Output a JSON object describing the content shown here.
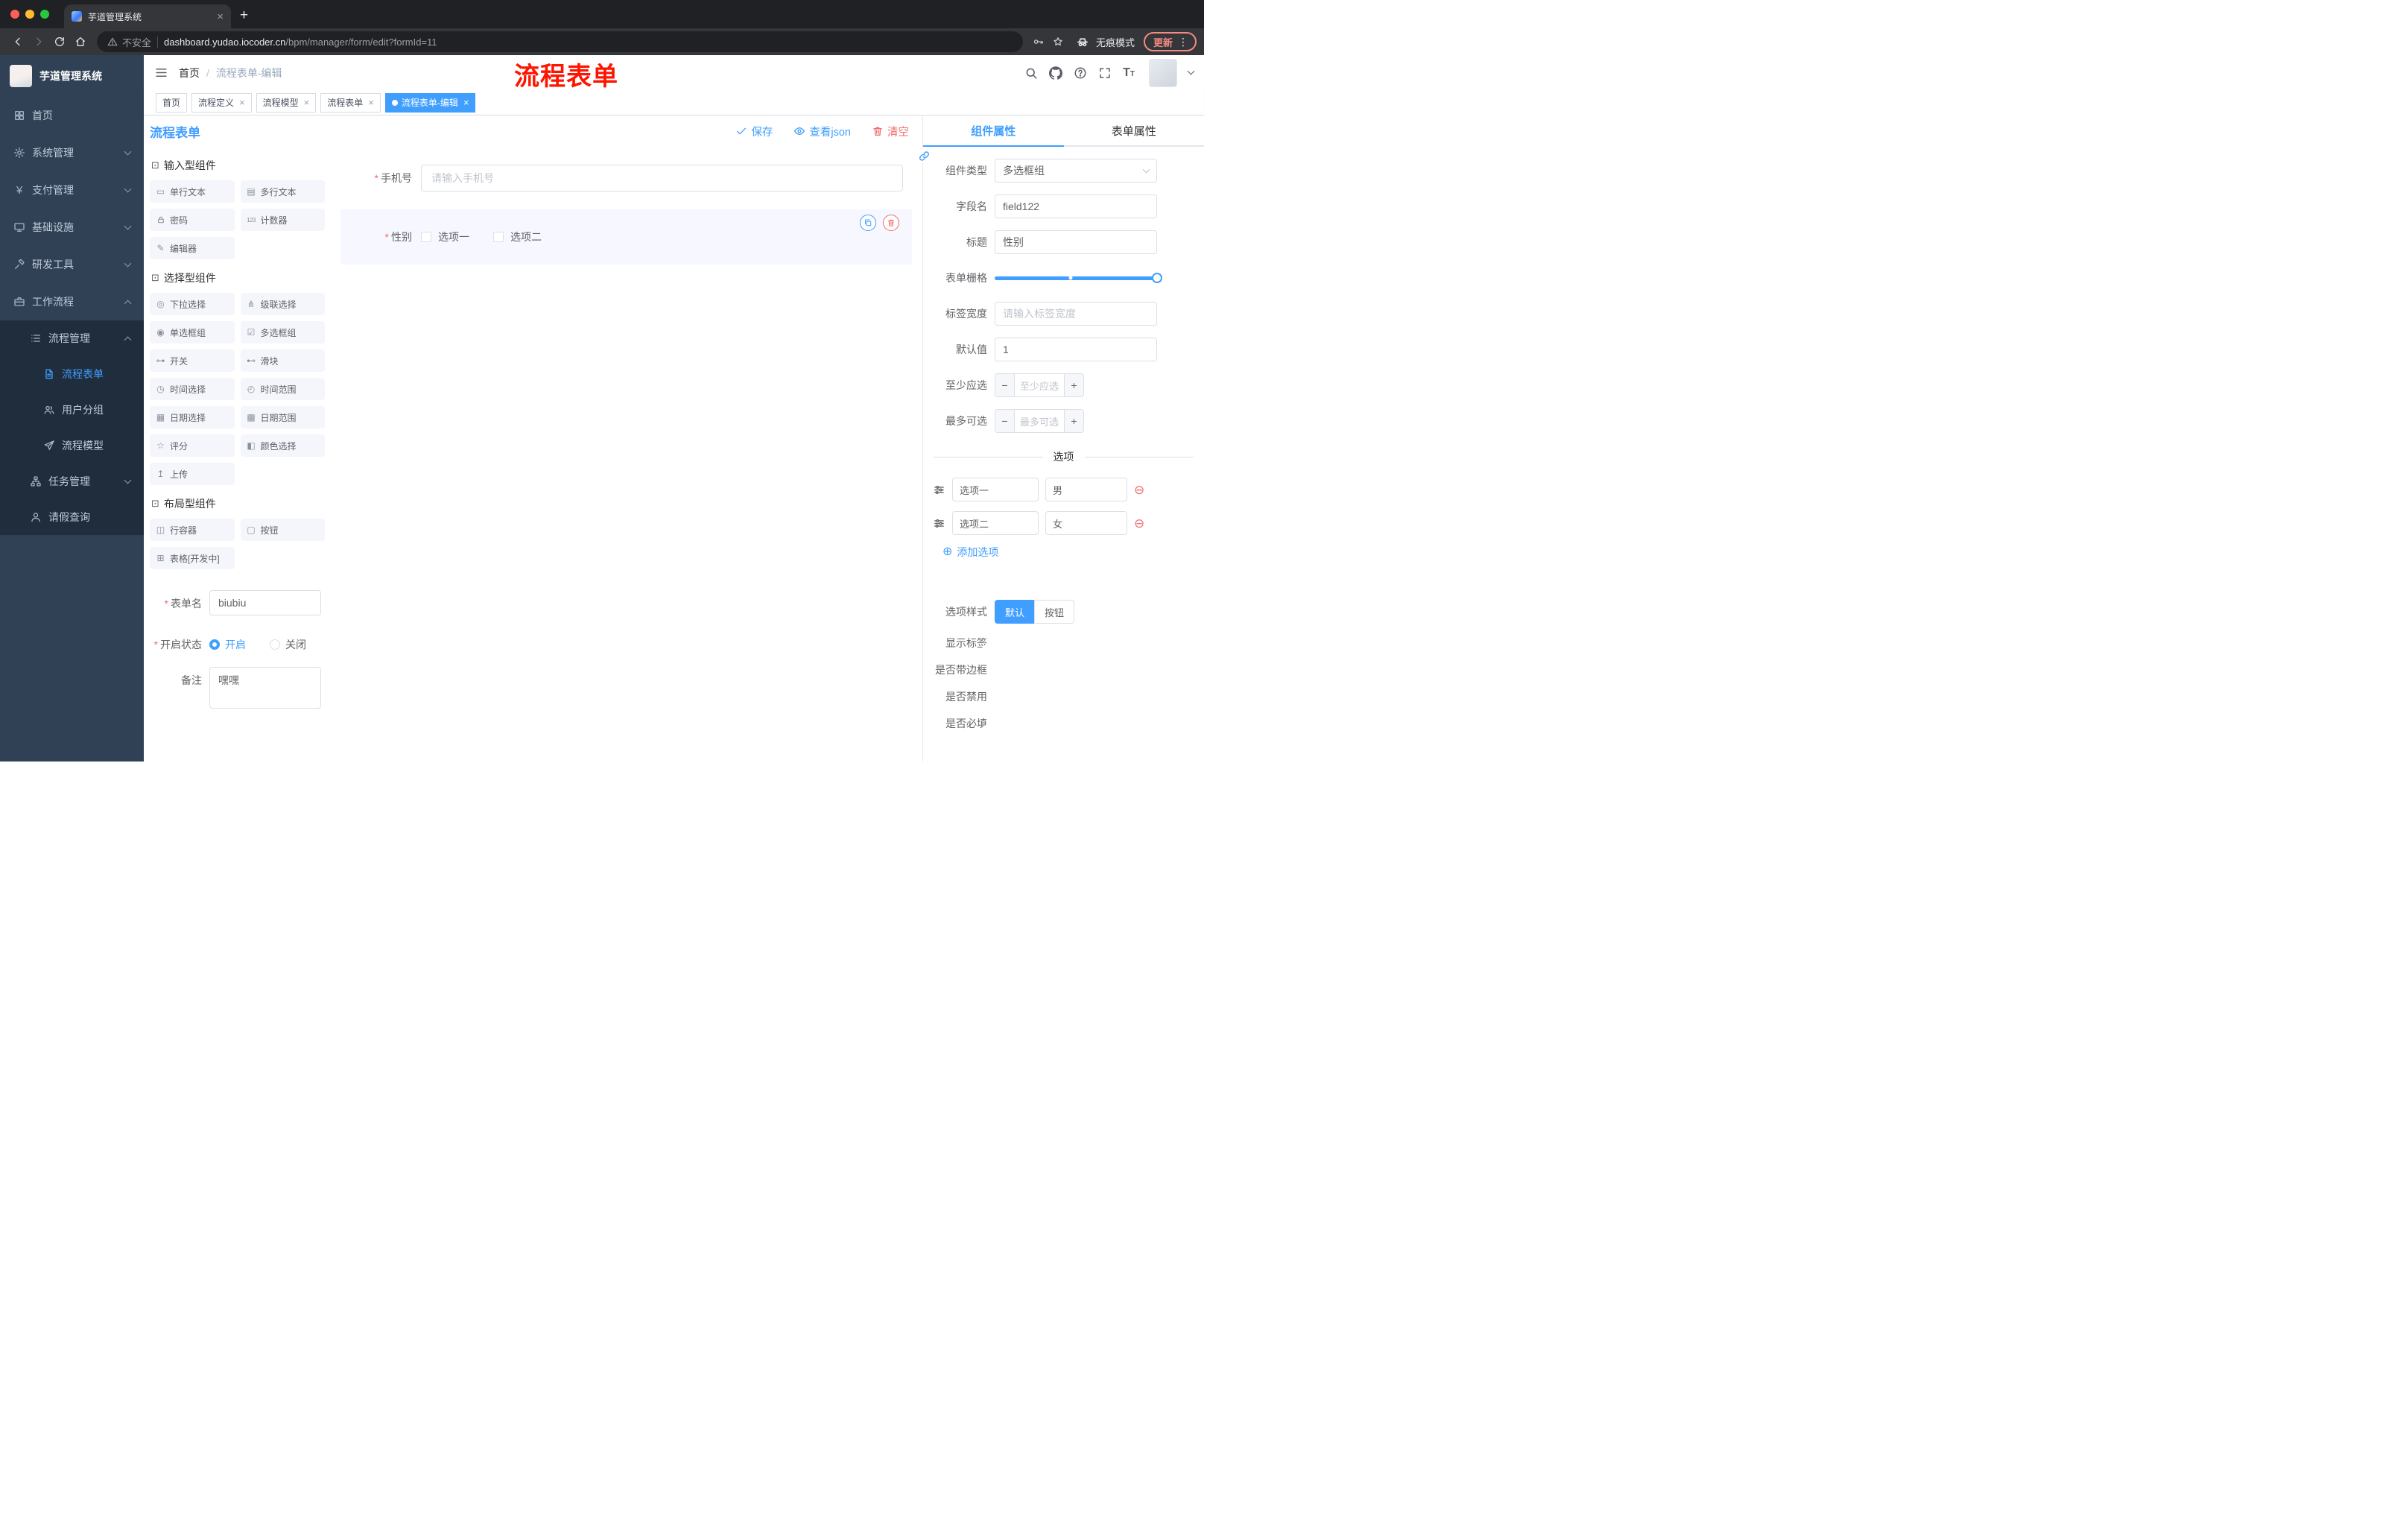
{
  "icons": {
    "yen": "¥",
    "input": "▭",
    "textarea": "▤",
    "counter": "123",
    "editor": "✎",
    "select": "◎",
    "cascader": "⋔",
    "radio": "◉",
    "checkbox_group": "☑",
    "switch": "⊶",
    "slider": "⊷",
    "time": "◷",
    "time_range": "◴",
    "date": "▦",
    "date_range": "▩",
    "rate": "☆",
    "color": "◧",
    "upload": "↥",
    "row": "◫",
    "button": "▢",
    "table": "⊞",
    "group": "⊡",
    "dots": "⋮",
    "minus_circle": "⊖",
    "plus_circle": "⊕",
    "close": "×",
    "plus": "+",
    "minus": "−",
    "slash": "/"
  },
  "browser": {
    "tab": {
      "title": "芋道管理系统"
    },
    "address": {
      "security_label": "不安全",
      "host": "dashboard.yudao.iocoder.cn",
      "path": "/bpm/manager/form/edit?formId=11"
    },
    "incognito_label": "无痕模式",
    "update_label": "更新"
  },
  "sidebar": {
    "logo_title": "芋道管理系统",
    "items": [
      {
        "label": "首页"
      },
      {
        "label": "系统管理"
      },
      {
        "label": "支付管理"
      },
      {
        "label": "基础设施"
      },
      {
        "label": "研发工具"
      },
      {
        "label": "工作流程"
      },
      {
        "label": "流程管理"
      },
      {
        "label": "流程表单"
      },
      {
        "label": "用户分组"
      },
      {
        "label": "流程模型"
      },
      {
        "label": "任务管理"
      },
      {
        "label": "请假查询"
      }
    ]
  },
  "navbar": {
    "breadcrumb": {
      "home": "首页",
      "current": "流程表单-编辑"
    },
    "annotation": "流程表单"
  },
  "tags": [
    {
      "label": "首页"
    },
    {
      "label": "流程定义"
    },
    {
      "label": "流程模型"
    },
    {
      "label": "流程表单"
    },
    {
      "label": "流程表单-编辑"
    }
  ],
  "designer": {
    "title": "流程表单",
    "actions": {
      "save": "保存",
      "view_json": "查看json",
      "clear": "清空"
    },
    "palette": {
      "groups": [
        {
          "title": "输入型组件",
          "items": [
            {
              "label": "单行文本"
            },
            {
              "label": "多行文本"
            },
            {
              "label": "密码"
            },
            {
              "label": "计数器"
            },
            {
              "label": "编辑器"
            }
          ]
        },
        {
          "title": "选择型组件",
          "items": [
            {
              "label": "下拉选择"
            },
            {
              "label": "级联选择"
            },
            {
              "label": "单选框组"
            },
            {
              "label": "多选框组"
            },
            {
              "label": "开关"
            },
            {
              "label": "滑块"
            },
            {
              "label": "时间选择"
            },
            {
              "label": "时间范围"
            },
            {
              "label": "日期选择"
            },
            {
              "label": "日期范围"
            },
            {
              "label": "评分"
            },
            {
              "label": "颜色选择"
            },
            {
              "label": "上传"
            }
          ]
        },
        {
          "title": "布局型组件",
          "items": [
            {
              "label": "行容器"
            },
            {
              "label": "按钮"
            },
            {
              "label": "表格[开发中]"
            }
          ]
        }
      ]
    },
    "form_meta": {
      "name_label": "表单名",
      "name_value": "biubiu",
      "status_label": "开启状态",
      "status_on": "开启",
      "status_off": "关闭",
      "remark_label": "备注",
      "remark_value": "嘿嘿"
    },
    "canvas": {
      "phone": {
        "label": "手机号",
        "placeholder": "请输入手机号"
      },
      "gender": {
        "label": "性别",
        "options": [
          "选项一",
          "选项二"
        ]
      }
    },
    "props": {
      "tabs": {
        "component": "组件属性",
        "form": "表单属性"
      },
      "component_type": {
        "label": "组件类型",
        "value": "多选框组"
      },
      "field_name": {
        "label": "字段名",
        "value": "field122"
      },
      "title": {
        "label": "标题",
        "value": "性别"
      },
      "grid": {
        "label": "表单栅格"
      },
      "label_width": {
        "label": "标签宽度",
        "placeholder": "请输入标签宽度"
      },
      "default_value": {
        "label": "默认值",
        "value": "1"
      },
      "min_select": {
        "label": "至少应选",
        "placeholder": "至少应选"
      },
      "max_select": {
        "label": "最多可选",
        "placeholder": "最多可选"
      },
      "options_divider": "选项",
      "options": [
        {
          "name": "选项一",
          "value": "男"
        },
        {
          "name": "选项二",
          "value": "女"
        }
      ],
      "add_option": "添加选项",
      "option_style": {
        "label": "选项样式",
        "default": "默认",
        "button": "按钮"
      },
      "switches": [
        {
          "label": "显示标签",
          "on": true
        },
        {
          "label": "是否带边框",
          "on": false
        },
        {
          "label": "是否禁用",
          "on": false
        },
        {
          "label": "是否必填",
          "on": true
        }
      ]
    }
  },
  "colors": {
    "primary": "#409eff",
    "danger": "#f56c6c",
    "annotation_red": "#fe1400",
    "sidebar_bg": "#304156",
    "submenu_bg": "#1f2d3d"
  }
}
